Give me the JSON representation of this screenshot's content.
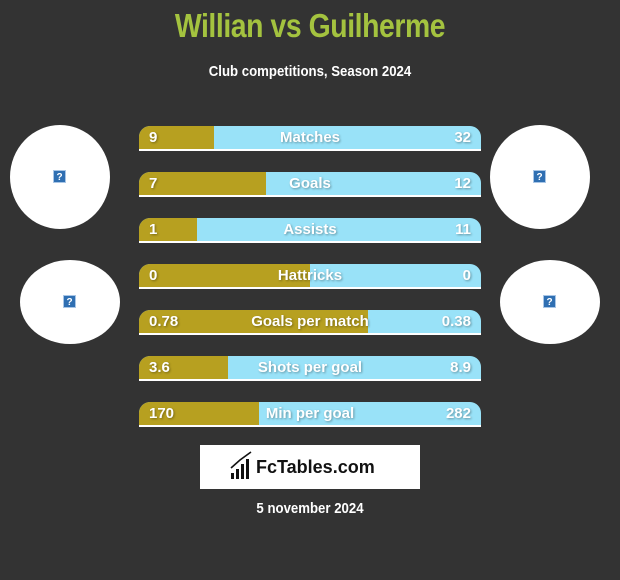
{
  "header": {
    "title": "Willian vs Guilherme",
    "subtitle": "Club competitions, Season 2024"
  },
  "players": {
    "left": {
      "name": "Willian",
      "avatar_icon": "missing-image-icon"
    },
    "right": {
      "name": "Guilherme",
      "avatar_icon": "missing-image-icon"
    }
  },
  "colors": {
    "left_bar": "#b7a020",
    "right_bar": "#99e2f8",
    "title": "#a4c33f",
    "background": "#333333"
  },
  "chart_data": {
    "type": "bar",
    "title": "Willian vs Guilherme",
    "subtitle": "Club competitions, Season 2024",
    "categories": [
      "Matches",
      "Goals",
      "Assists",
      "Hattricks",
      "Goals per match",
      "Shots per goal",
      "Min per goal"
    ],
    "series": [
      {
        "name": "Willian",
        "values": [
          9,
          7,
          1,
          0,
          0.78,
          3.6,
          170
        ],
        "labels": [
          "9",
          "7",
          "1",
          "0",
          "0.78",
          "3.6",
          "170"
        ]
      },
      {
        "name": "Guilherme",
        "values": [
          32,
          12,
          11,
          0,
          0.38,
          8.9,
          282
        ],
        "labels": [
          "32",
          "12",
          "11",
          "0",
          "0.38",
          "8.9",
          "282"
        ]
      }
    ],
    "left_share": [
      0.22,
      0.37,
      0.17,
      0.5,
      0.67,
      0.26,
      0.35
    ]
  },
  "footer": {
    "logo_text": "FcTables.com",
    "date": "5 november 2024"
  }
}
